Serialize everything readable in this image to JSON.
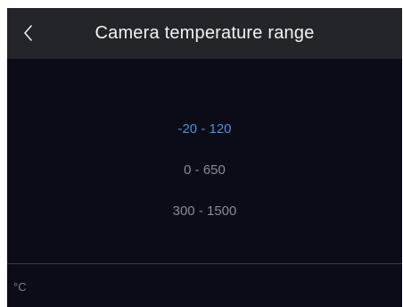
{
  "header": {
    "title": "Camera temperature range",
    "back_icon": "chevron-left-icon"
  },
  "ranges": {
    "selected_index": 0,
    "options": [
      {
        "label": "-20 - 120"
      },
      {
        "label": "0 - 650"
      },
      {
        "label": "300 - 1500"
      }
    ]
  },
  "footer": {
    "unit": "°C"
  },
  "colors": {
    "background": "#0b0c17",
    "header": "#24252b",
    "selected": "#4e8fdc",
    "unselected": "#8a8b93"
  }
}
